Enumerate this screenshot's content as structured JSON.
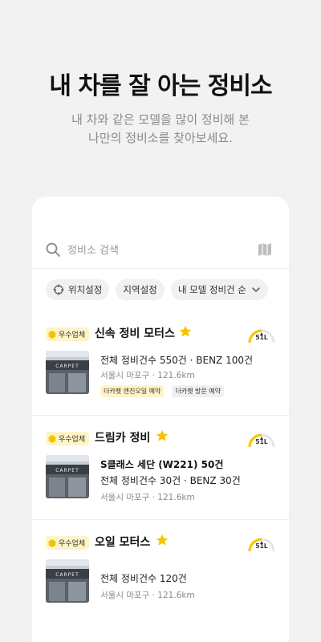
{
  "hero": {
    "title": "내 차를 잘 아는 정비소",
    "subtitle_line1": "내 차와 같은 모델을 많이 정비해 본",
    "subtitle_line2": "나만의 정비소를 찾아보세요."
  },
  "search": {
    "placeholder": "정비소 검색",
    "search_icon": "search-icon",
    "map_icon": "map-icon"
  },
  "filters": {
    "location": "위치설정",
    "region": "지역설정",
    "sort": "내 모델 정비건 순"
  },
  "colors": {
    "accent": "#f5c400",
    "badge_bg": "#fff4c7",
    "muted": "#8a8a8a"
  },
  "shops": [
    {
      "badge": "우수업체",
      "name": "신속 정비 모터스",
      "rating_level": "51L",
      "model_line": "",
      "stats": "전체 정비건수 550건 · BENZ 100건",
      "address": "서울시 마포구 · 121.6km",
      "tags": [
        "더카펫 엔진오일 예약",
        "더카펫 방문 예약"
      ],
      "thumb_sign": "CARPET"
    },
    {
      "badge": "우수업체",
      "name": "드림카 정비",
      "rating_level": "51L",
      "model_line": "S클래스 세단 (W221) 50건",
      "stats": "전체 정비건수 30건 · BENZ 30건",
      "address": "서울시 마포구 · 121.6km",
      "tags": [],
      "thumb_sign": "CARPET"
    },
    {
      "badge": "우수업체",
      "name": "오일 모터스",
      "rating_level": "51L",
      "model_line": "",
      "stats": "전체 정비건수 120건",
      "address": "서울시 마포구 · 121.6km",
      "tags": [],
      "thumb_sign": "CARPET"
    }
  ]
}
